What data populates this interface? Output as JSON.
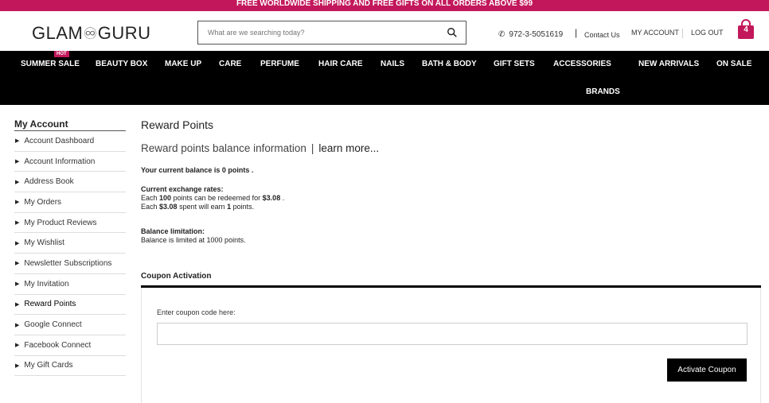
{
  "promo": "FREE WORLDWIDE SHIPPING AND FREE GIFTS ON ALL ORDERS ABOVE $99",
  "logo": {
    "left": "GLAM",
    "mid": "♾",
    "right": "GURU"
  },
  "search": {
    "placeholder": "What are we searching today?"
  },
  "header": {
    "phone": "972-3-5051619",
    "separator": "|",
    "contact": "Contact Us",
    "my_account": "MY ACCOUNT",
    "logout": "LOG OUT",
    "cart_count": "4"
  },
  "nav": {
    "hot_badge": "HOT",
    "items": [
      "SUMMER SALE",
      "BEAUTY BOX",
      "MAKE UP",
      "CARE",
      "PERFUME",
      "HAIR CARE",
      "NAILS",
      "BATH & BODY",
      "GIFT SETS",
      "ACCESSORIES",
      "NEW ARRIVALS",
      "ON SALE",
      "BRANDS"
    ]
  },
  "sidebar": {
    "title": "My Account",
    "items": [
      "Account Dashboard",
      "Account Information",
      "Address Book",
      "My Orders",
      "My Product Reviews",
      "My Wishlist",
      "Newsletter Subscriptions",
      "My Invitation",
      "Reward Points",
      "Google Connect",
      "Facebook Connect",
      "My Gift Cards"
    ]
  },
  "main": {
    "title": "Reward Points",
    "subtitle": "Reward points balance information",
    "sub_sep": "|",
    "learn_more": "learn more...",
    "balance": "Your current balance is 0 points .",
    "rates_title": "Current exchange rates:",
    "rate1_a": "Each",
    "rate1_b": "100",
    "rate1_c": "points can be redeemed for",
    "rate1_d": "$3.08",
    "rate1_e": ".",
    "rate2_a": "Each",
    "rate2_b": "$3.08",
    "rate2_c": "spent will earn",
    "rate2_d": "1",
    "rate2_e": "points.",
    "limit_title": "Balance limitation:",
    "limit_text": "Balance is limited at 1000 points.",
    "coupon_title": "Coupon Activation",
    "coupon_label": "Enter coupon code here:",
    "coupon_value": "",
    "coupon_button": "Activate Coupon"
  }
}
